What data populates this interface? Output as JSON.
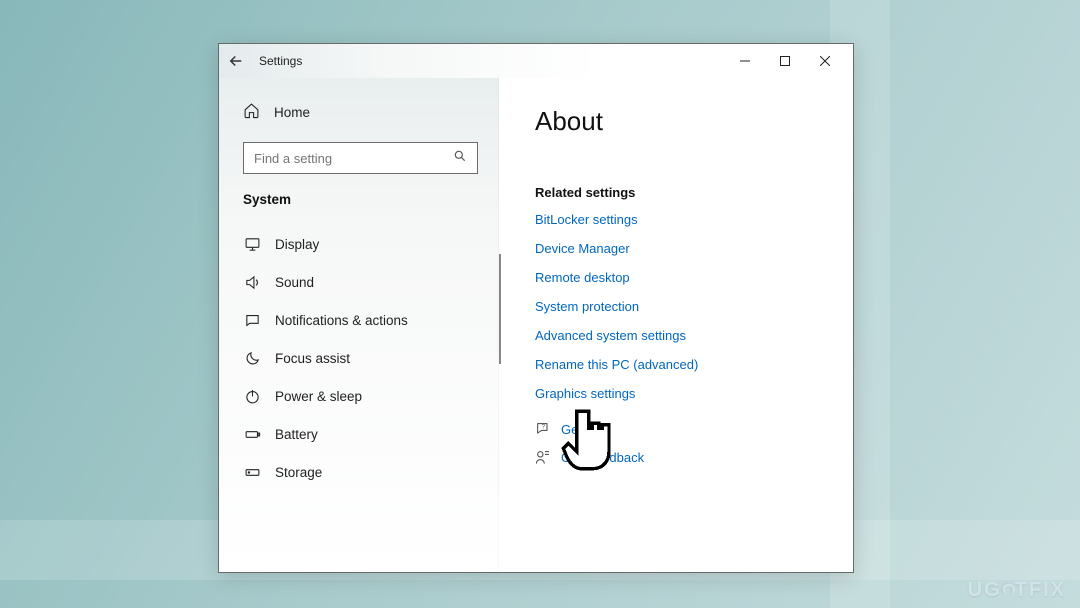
{
  "titlebar": {
    "title": "Settings"
  },
  "sidebar": {
    "home": "Home",
    "search_placeholder": "Find a setting",
    "category": "System",
    "items": [
      {
        "label": "Display"
      },
      {
        "label": "Sound"
      },
      {
        "label": "Notifications & actions"
      },
      {
        "label": "Focus assist"
      },
      {
        "label": "Power & sleep"
      },
      {
        "label": "Battery"
      },
      {
        "label": "Storage"
      }
    ]
  },
  "content": {
    "page_title": "About",
    "related_header": "Related settings",
    "related_links": [
      "BitLocker settings",
      "Device Manager",
      "Remote desktop",
      "System protection",
      "Advanced system settings",
      "Rename this PC (advanced)",
      "Graphics settings"
    ],
    "help_label": "Get help",
    "feedback_label": "Give feedback"
  },
  "watermark": "UGETFIX"
}
